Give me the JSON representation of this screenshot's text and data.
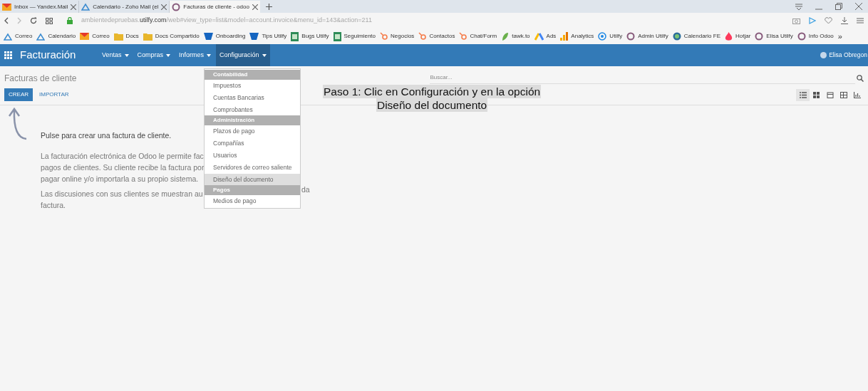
{
  "browser": {
    "tabs": [
      {
        "label": "Inbox — Yandex.Mail",
        "selected": false
      },
      {
        "label": "Calendario - Zoho Mail (el",
        "selected": false
      },
      {
        "label": "Facturas de cliente - odoo",
        "selected": true
      }
    ],
    "url_host": "ambientedepruebas.",
    "url_domain": "utilfy.com",
    "url_path": "/web#view_type=list&model=account.invoice&menu_id=143&action=211",
    "bookmarks": [
      "Correo",
      "Calendario",
      "Correo",
      "Docs",
      "Docs Compartido",
      "Onboarding",
      "Tips Utilfy",
      "Bugs Utilfy",
      "Seguimiento",
      "Negocios",
      "Contactos",
      "Chat/Form",
      "tawk.to",
      "Ads",
      "Analytics",
      "Utilfy",
      "Admin Utilfy",
      "Calendario FE",
      "Hotjar",
      "Elisa Utilfy",
      "Info Odoo"
    ],
    "more": "»"
  },
  "app": {
    "title": "Facturación",
    "menus": [
      {
        "label": "Ventas",
        "selected": false
      },
      {
        "label": "Compras",
        "selected": false
      },
      {
        "label": "Informes",
        "selected": false
      },
      {
        "label": "Configuración",
        "selected": true
      }
    ],
    "user": "Elisa Obregon"
  },
  "control_panel": {
    "breadcrumb": "Facturas de cliente",
    "create": "CREAR",
    "import": "IMPORTAR",
    "search": {
      "placeholder": "Buscar..."
    },
    "views": [
      {
        "kind": "list",
        "selected": true
      },
      {
        "kind": "kanban",
        "selected": false
      },
      {
        "kind": "calendar",
        "selected": false
      },
      {
        "kind": "pivot",
        "selected": false
      },
      {
        "kind": "graph",
        "selected": false
      }
    ]
  },
  "help": {
    "title": "Pulse para crear una factura de cliente.",
    "paragraphs": [
      {
        "lines": [
          {
            "text": "La facturación electrónica de Odoo le permite fac"
          },
          {
            "text": "pagos de clientes. Su cliente recibe la factura por"
          },
          {
            "text": "pagar online y/o importarla a su propio sistema."
          }
        ]
      },
      {
        "lines": [
          {
            "text": "Las discusiones con sus clientes se muestran au",
            "tail": "da"
          },
          {
            "text": "factura."
          }
        ]
      }
    ]
  },
  "dropdown": [
    {
      "kind": "header",
      "label": "Contabilidad"
    },
    {
      "kind": "item",
      "label": "Impuestos",
      "hover": false
    },
    {
      "kind": "item",
      "label": "Cuentas Bancarias",
      "hover": false
    },
    {
      "kind": "item",
      "label": "Comprobantes",
      "hover": false
    },
    {
      "kind": "header",
      "label": "Administración"
    },
    {
      "kind": "item",
      "label": "Plazos de pago",
      "hover": false
    },
    {
      "kind": "item",
      "label": "Compañías",
      "hover": false
    },
    {
      "kind": "item",
      "label": "Usuarios",
      "hover": false
    },
    {
      "kind": "item",
      "label": "Servidores de correo saliente",
      "hover": false
    },
    {
      "kind": "item",
      "label": "Diseño del documento",
      "hover": true
    },
    {
      "kind": "header",
      "label": "Pagos"
    },
    {
      "kind": "item",
      "label": "Medios de pago",
      "hover": false
    }
  ],
  "caption": [
    "Paso 1: Clic en Configuración y en la opción",
    "Diseño del documento"
  ]
}
